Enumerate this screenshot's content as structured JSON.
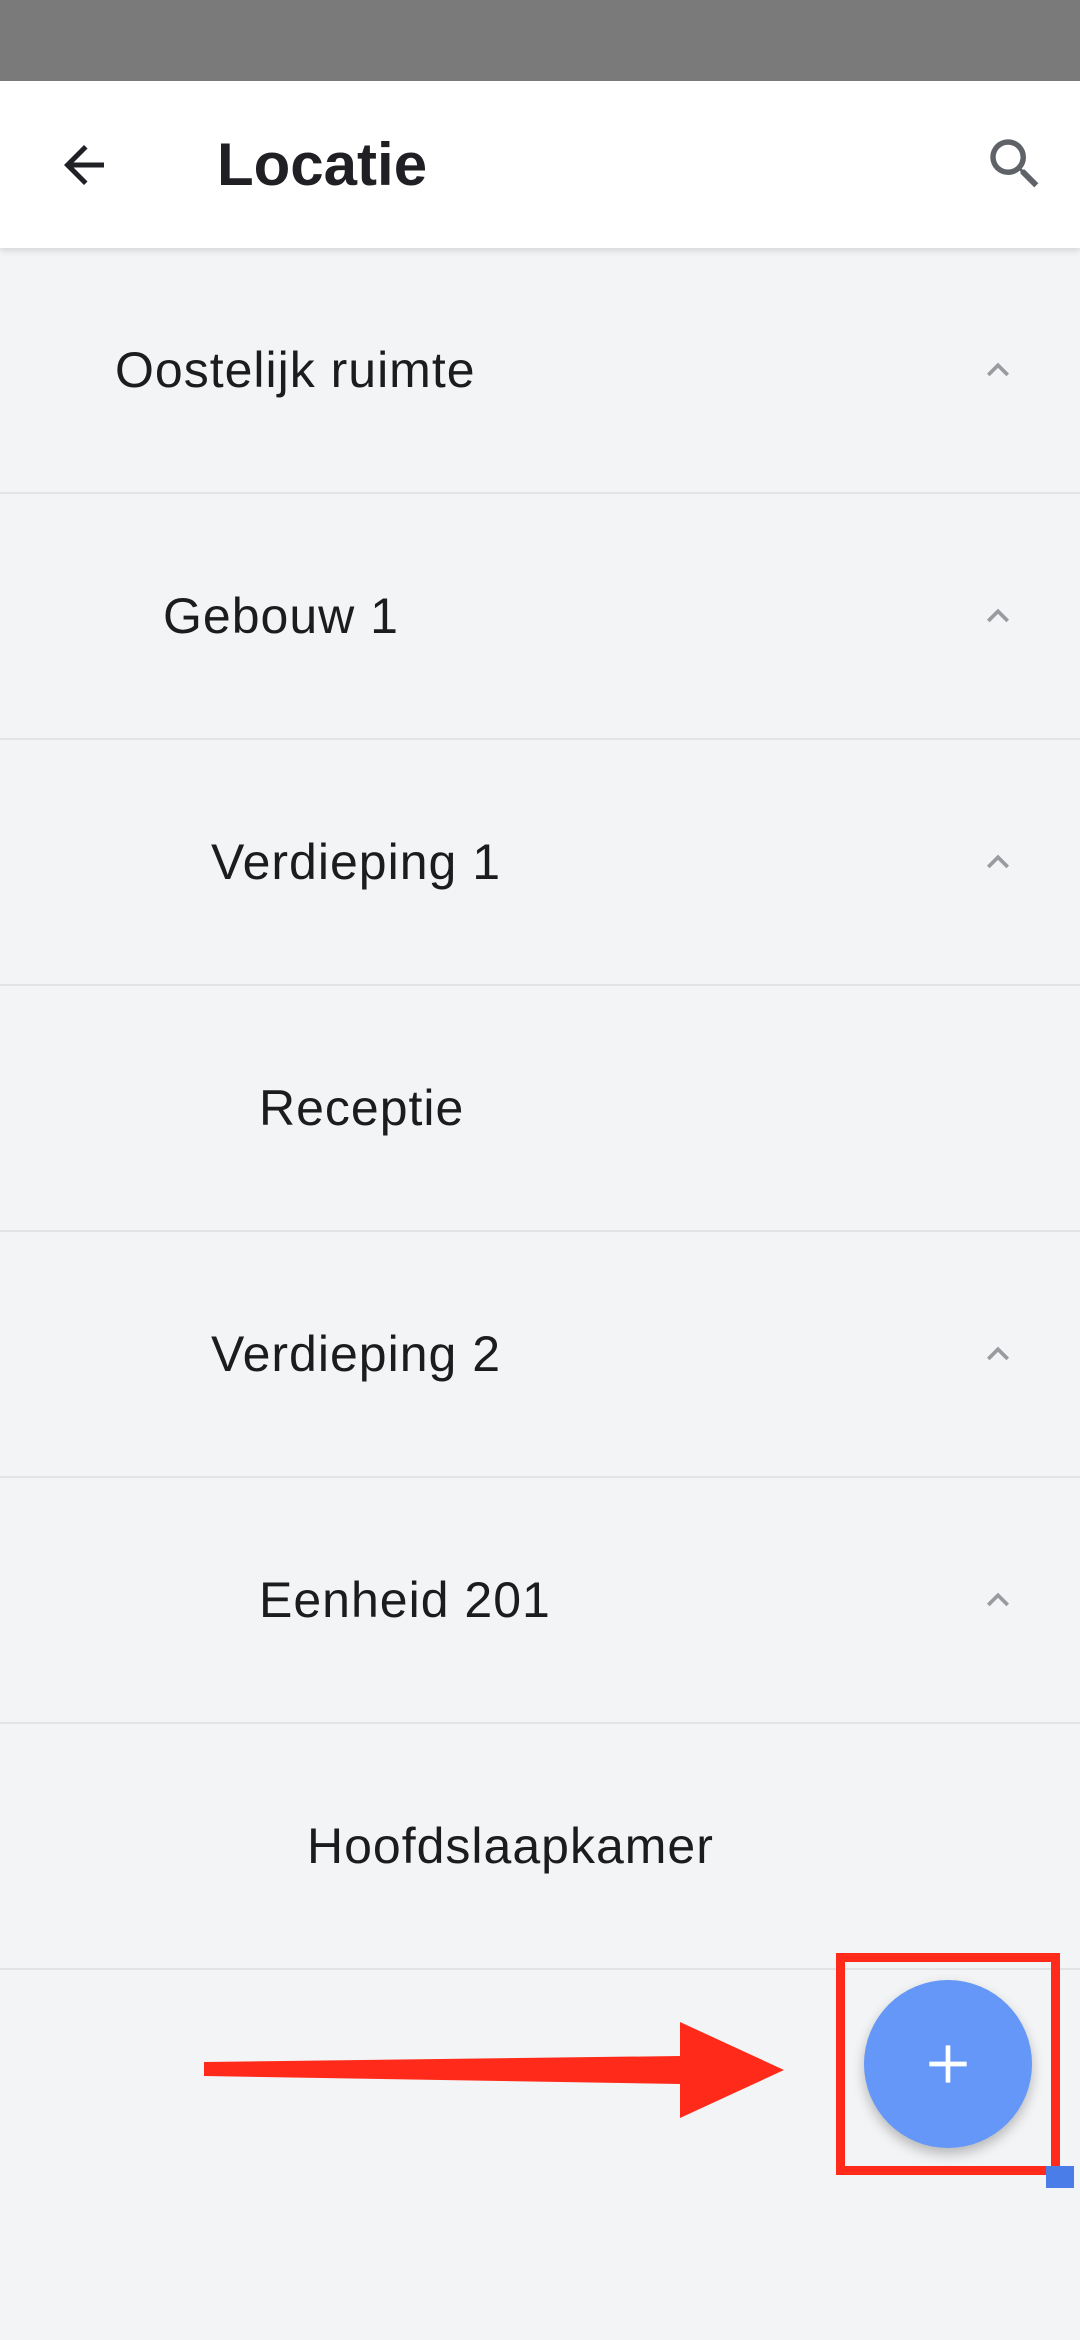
{
  "app_bar": {
    "title": "Locatie",
    "back_icon": "arrow-left-icon",
    "search_icon": "search-icon"
  },
  "tree": {
    "items": [
      {
        "label": "Oostelijk ruimte",
        "level": 1,
        "expanded": true
      },
      {
        "label": "Gebouw 1",
        "level": 2,
        "expanded": true
      },
      {
        "label": "Verdieping 1",
        "level": 3,
        "expanded": true
      },
      {
        "label": "Receptie",
        "level": 4,
        "expanded": null
      },
      {
        "label": "Verdieping 2",
        "level": 3,
        "expanded": true
      },
      {
        "label": "Eenheid 201",
        "level": 4,
        "expanded": true
      },
      {
        "label": "Hoofdslaapkamer",
        "level": 5,
        "expanded": null
      }
    ]
  },
  "fab": {
    "icon": "plus-icon"
  },
  "annotation": {
    "color": "#ff2a1a"
  },
  "colors": {
    "accent": "#6497f7",
    "background": "#f3f4f6"
  }
}
